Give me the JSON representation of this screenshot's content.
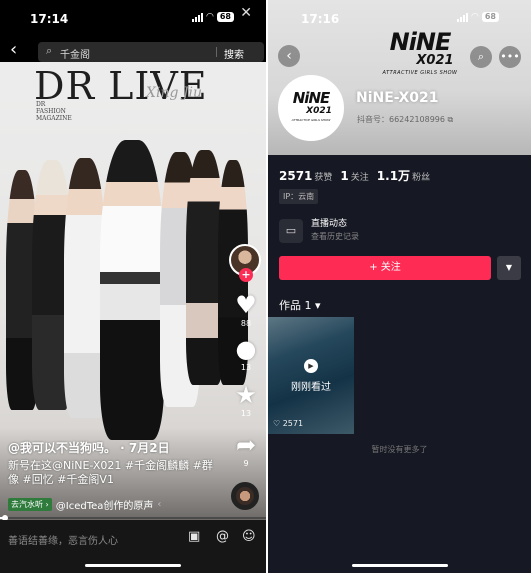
{
  "left": {
    "status": {
      "time": "17:14",
      "battery": "68"
    },
    "search": {
      "query": "千金阁",
      "button_label": "搜索"
    },
    "video": {
      "magazine_title": "DR LIVE",
      "magazine_script": "Xing Jiu",
      "magazine_sub": "DR\nFASHION\nMAGAZINE"
    },
    "actions": {
      "likes": "88",
      "comments": "13",
      "favorites": "13",
      "shares": "9"
    },
    "caption": {
      "username": "@我可以不当狗吗。 · 7月2日",
      "description": "新号在这@NiNE-X021 #千金阁麟麟 #群像 #回忆 #千金阁V1"
    },
    "music": {
      "tag": "去汽水听 ›",
      "text": "@IcedTea创作的原声"
    },
    "progress": 0.02,
    "comment_placeholder": "善语结善缘，恶言伤人心",
    "icons": [
      "back-arrow-icon",
      "search-icon",
      "heart-icon",
      "comment-icon",
      "star-icon",
      "share-icon",
      "image-icon",
      "at-icon",
      "emoji-icon"
    ]
  },
  "right": {
    "status": {
      "time": "17:16",
      "battery": "68"
    },
    "logo": {
      "line1": "NiNE",
      "line2": "X021",
      "line3": "ATTRACTIVE GIRLS SHOW"
    },
    "nickname": "NiNE-X021",
    "douyin_id": "抖音号：66242108996",
    "stats": [
      {
        "value": "2571",
        "label": "获赞"
      },
      {
        "value": "1",
        "label": "关注"
      },
      {
        "value": "1.1万",
        "label": "粉丝"
      }
    ],
    "ip": "IP：云南",
    "live": {
      "title": "直播动态",
      "subtitle": "查看历史记录"
    },
    "follow_label": "+ 关注",
    "works_tab": "作品 1 ▾",
    "thumb": {
      "label": "刚刚看过",
      "likes": "2571"
    },
    "no_more": "暂时没有更多了"
  },
  "colors": {
    "accent": "#fe2c55",
    "panel": "#161823"
  }
}
